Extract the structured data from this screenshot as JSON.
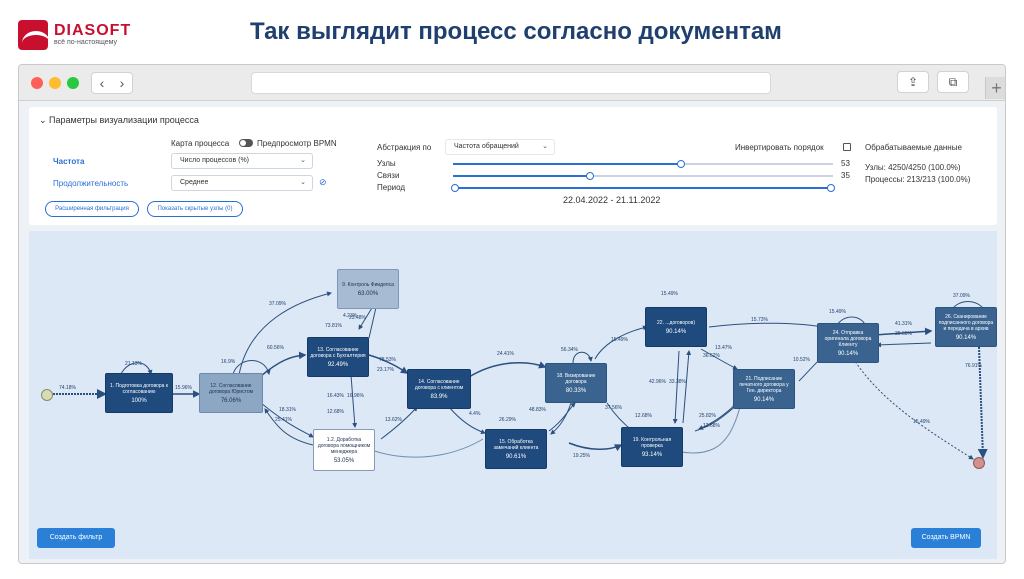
{
  "slide": {
    "logo_name": "DIASOFT",
    "logo_tag": "всё по-настоящему",
    "title": "Так выглядит процесс согласно документам"
  },
  "browser": {
    "back": "‹",
    "forward": "›",
    "share": "⇪",
    "tabs": "⧉",
    "plus": "+"
  },
  "params": {
    "header": "Параметры визуализации процесса",
    "process_map_label": "Карта процесса",
    "bpmn_preview_label": "Предпросмотр BPMN",
    "frequency_label": "Частота",
    "frequency_value": "Число процессов (%)",
    "duration_label": "Продолжительность",
    "duration_value": "Среднее",
    "advanced_filter": "Расширенная фильтрация",
    "show_hidden": "Показать скрытые узлы (0)",
    "abstraction_label": "Абстракция по",
    "abstraction_value": "Частота обращений",
    "invert_label": "Инвертировать порядок",
    "nodes_label": "Узлы",
    "nodes_value": "53",
    "links_label": "Связи",
    "links_value": "35",
    "period_label": "Период",
    "period_range": "22.04.2022 - 21.11.2022",
    "processed_title": "Обрабатываемые данные",
    "processed_nodes": "Узлы: 4250/4250 (100.0%)",
    "processed_processes": "Процессы: 213/213 (100.0%)",
    "nodes_level": 0.6,
    "links_level": 0.36
  },
  "nodes": [
    {
      "label": "1. Подготовка договора к согласованию",
      "pct": "100%"
    },
    {
      "label": "12. Согласование договора Юристом",
      "pct": "76.06%"
    },
    {
      "label": "9. Контроль Фиидепса",
      "pct": "63.00%"
    },
    {
      "label": "13. Согласование договора с Бухгалтерия",
      "pct": "92.49%"
    },
    {
      "label": "1.2. Доработка договора помощником менеджера",
      "pct": "53.05%"
    },
    {
      "label": "14. Согласование договора с клиентом",
      "pct": "83.9%"
    },
    {
      "label": "15. Обработка замечаний клиента",
      "pct": "90.61%"
    },
    {
      "label": "18. Визирование договора",
      "pct": "80.33%"
    },
    {
      "label": "22. ...договоров)",
      "pct": "90.14%"
    },
    {
      "label": "19. Контрольная проверка",
      "pct": "93.14%"
    },
    {
      "label": "21. Подписание печатного договора у Ген. директора",
      "pct": "90.14%"
    },
    {
      "label": "24. Отправка оригинала договора Клиенту",
      "pct": "90.14%"
    },
    {
      "label": "26. Сканирование подписанного договора и передача в архив",
      "pct": "90.14%"
    }
  ],
  "edges": [
    "74.18%",
    "21.13%",
    "15.96%",
    "16.9%",
    "37.09%",
    "60.56%",
    "4.23%",
    "73.81%",
    "23.48%",
    "78.53%",
    "23.17%",
    "16.43%",
    "16.96%",
    "18.31%",
    "25.41%",
    "12.68%",
    "13.62%",
    "24.41%",
    "4.4%",
    "26.29%",
    "48.83%",
    "37.56%",
    "56.34%",
    "15.49%",
    "15.49%",
    "36.62%",
    "42.96%",
    "33.38%",
    "13.47%",
    "12.68%",
    "25.82%",
    "12.68%",
    "19.25%",
    "15.73%",
    "10.52%",
    "15.49%",
    "41.31%",
    "39.65%",
    "37.09%",
    "76.91%",
    "15.49%"
  ],
  "buttons": {
    "create_filter": "Создать фильтр",
    "create_bpmn": "Создать BPMN"
  }
}
